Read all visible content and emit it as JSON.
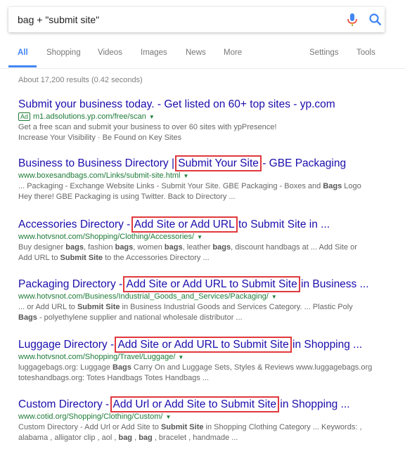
{
  "search": {
    "query": "bag + \"submit site\"",
    "mic_icon": "microphone-icon",
    "search_icon": "magnifier-icon",
    "accent": "#4285f4"
  },
  "tabs": [
    {
      "label": "All",
      "active": true
    },
    {
      "label": "Shopping"
    },
    {
      "label": "Videos"
    },
    {
      "label": "Images"
    },
    {
      "label": "News"
    },
    {
      "label": "More"
    }
  ],
  "tools": {
    "settings": "Settings",
    "tools": "Tools"
  },
  "stats": "About 17,200 results (0.42 seconds)",
  "highlight_color": "#e0393e",
  "results": [
    {
      "pre": "Submit your business today. - Get listed on 60+ top sites - yp.com",
      "hl": "",
      "post": "",
      "ad": "Ad",
      "url": "m1.adsolutions.yp.com/free/scan",
      "snippet": [
        [
          {
            "t": "Get a free scan and submit your business to over 60 sites with ypPresence!"
          }
        ],
        [
          {
            "t": "Increase Your Visibility · Be Found on Key Sites"
          }
        ]
      ]
    },
    {
      "pre": "Business to Business Directory | ",
      "hl": "Submit Your Site",
      "post": " - GBE Packaging",
      "url": "www.boxesandbags.com/Links/submit-site.html",
      "snippet": [
        [
          {
            "t": "... Packaging - Exchange Website Links - Submit Your Site. GBE Packaging - Boxes and "
          },
          {
            "t": "Bags",
            "b": true
          },
          {
            "t": " Logo"
          }
        ],
        [
          {
            "t": "Hey there! GBE Packaging is using Twitter. Back to Directory ..."
          }
        ]
      ]
    },
    {
      "pre": "Accessories Directory - ",
      "hl": "Add Site or Add URL",
      "post": " to Submit Site in ...",
      "url": "www.hotvsnot.com/Shopping/Clothing/Accessories/",
      "snippet": [
        [
          {
            "t": "Buy designer "
          },
          {
            "t": "bags",
            "b": true
          },
          {
            "t": ", fashion "
          },
          {
            "t": "bags",
            "b": true
          },
          {
            "t": ", women "
          },
          {
            "t": "bags",
            "b": true
          },
          {
            "t": ", leather "
          },
          {
            "t": "bags",
            "b": true
          },
          {
            "t": ", discount handbags at ... Add Site or"
          }
        ],
        [
          {
            "t": "Add URL to "
          },
          {
            "t": "Submit Site",
            "b": true
          },
          {
            "t": " to the Accessories Directory ..."
          }
        ]
      ]
    },
    {
      "pre": "Packaging Directory - ",
      "hl": "Add Site or Add URL to Submit Site",
      "post": " in Business ...",
      "url": "www.hotvsnot.com/Business/Industrial_Goods_and_Services/Packaging/",
      "snippet": [
        [
          {
            "t": "... or Add URL to "
          },
          {
            "t": "Submit Site",
            "b": true
          },
          {
            "t": " in Business Industrial Goods and Services Category. ... Plastic Poly"
          }
        ],
        [
          {
            "t": "Bags",
            "b": true
          },
          {
            "t": " - polyethylene supplier and national wholesale distributor ..."
          }
        ]
      ]
    },
    {
      "pre": "Luggage Directory - ",
      "hl": "Add Site or Add URL to Submit Site",
      "post": " in Shopping ...",
      "url": "www.hotvsnot.com/Shopping/Travel/Luggage/",
      "snippet": [
        [
          {
            "t": "luggagebags.org: Luggage "
          },
          {
            "t": "Bags",
            "b": true
          },
          {
            "t": " Carry On and Luggage Sets, Styles & Reviews www.luggagebags.org"
          }
        ],
        [
          {
            "t": "toteshandbags.org: Totes Handbags Totes Handbags ..."
          }
        ]
      ]
    },
    {
      "pre": "Custom Directory - ",
      "hl": "Add Url or Add Site to Submit Site",
      "post": " in Shopping ...",
      "url": "www.cotid.org/Shopping/Clothing/Custom/",
      "snippet": [
        [
          {
            "t": "Custom Directory - Add Url or Add Site to "
          },
          {
            "t": "Submit Site",
            "b": true
          },
          {
            "t": " in Shopping Clothing Category ... Keywords: ,"
          }
        ],
        [
          {
            "t": "alabama , alligator clip , aol , "
          },
          {
            "t": "bag",
            "b": true
          },
          {
            "t": " , "
          },
          {
            "t": "bag",
            "b": true
          },
          {
            "t": " , bracelet , handmade ..."
          }
        ]
      ]
    }
  ]
}
